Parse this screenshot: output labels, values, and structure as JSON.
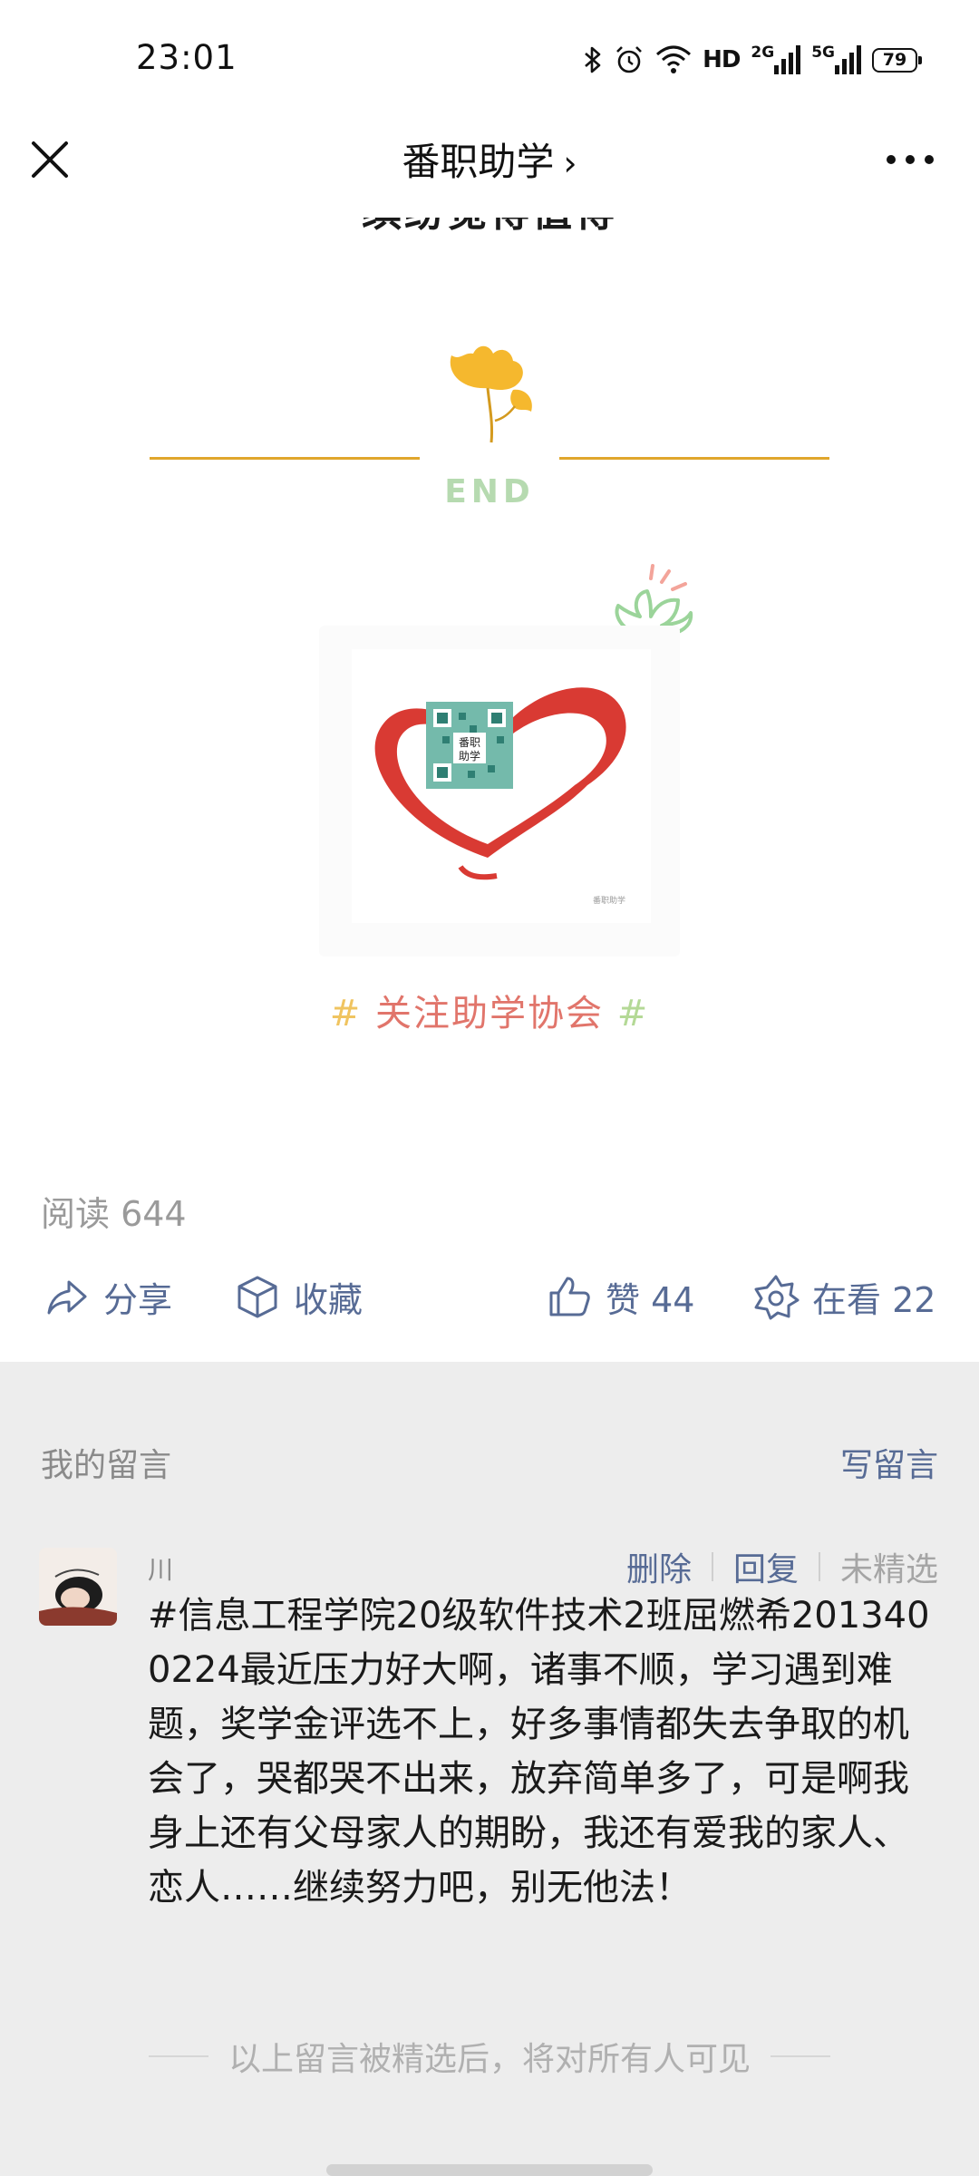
{
  "status_bar": {
    "time": "23:01",
    "icons": [
      "bluetooth-icon",
      "alarm-icon",
      "wifi-icon",
      "hd-icon",
      "signal-2g-icon",
      "signal-5g-icon",
      "battery-icon"
    ],
    "hd_label": "HD",
    "net1_label": "2G",
    "net2_label": "5G",
    "battery_level": "79"
  },
  "nav": {
    "title": "番职助学",
    "chevron": "›"
  },
  "article": {
    "cut_off_text": "缤纷觉得值得",
    "end_label": "END",
    "qr_text": "番职\n助学",
    "qr_watermark": "番职助学",
    "caption_hash_left": "#",
    "caption_text": "关注助学协会",
    "caption_hash_right": "#",
    "read_label": "阅读 644"
  },
  "actions": {
    "share": "分享",
    "favorite": "收藏",
    "like": "赞 44",
    "watching": "在看 22"
  },
  "comments": {
    "section_title": "我的留言",
    "write_button": "写留言",
    "item": {
      "nickname": "川",
      "delete": "删除",
      "reply": "回复",
      "status": "未精选",
      "text": "#信息工程学院20级软件技术2班屈燃希2013400224最近压力好大啊，诸事不顺，学习遇到难题，奖学金评选不上，好多事情都失去争取的机会了，哭都哭不出来，放弃简单多了，可是啊我身上还有父母家人的期盼，我还有爱我的家人、恋人……继续努力吧，别无他法！"
    },
    "footnote": "以上留言被精选后，将对所有人可见"
  },
  "colors": {
    "link": "#576b95",
    "end_line": "#e0a62c",
    "end_text": "#b6dab0",
    "caption": "#e1756b",
    "comment_bg": "#ededed"
  }
}
